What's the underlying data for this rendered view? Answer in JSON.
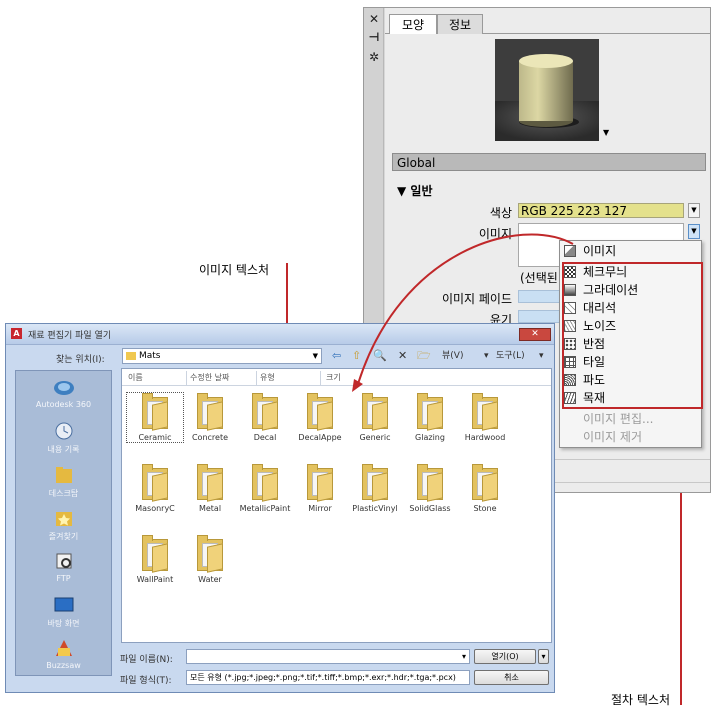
{
  "callouts": {
    "image_texture": "이미지 텍스처",
    "procedural_texture": "절차 텍스처"
  },
  "palette": {
    "strip_icons": [
      "close-icon",
      "pin-icon",
      "settings-icon"
    ],
    "strip_glyphs": [
      "✕",
      "⊣",
      "✲"
    ],
    "tabs": [
      "모양",
      "정보"
    ],
    "material_name": "Global",
    "section_label": "▼ 일반",
    "props": {
      "color_label": "색상",
      "color_value": "RGB 225 223 127",
      "image_label": "이미지",
      "image_placeholder": "(선택된",
      "image_fade_label": "이미지 페이드",
      "gloss_label": "윤기"
    },
    "colors": {
      "color_field": "#e4e18c",
      "accent_red": "#c0282a"
    }
  },
  "menu": {
    "top_item": "이미지",
    "procedural_items": [
      "체크무늬",
      "그라데이션",
      "대리석",
      "노이즈",
      "반점",
      "타일",
      "파도",
      "목재"
    ],
    "disabled_items": [
      "이미지 편집...",
      "이미지 제거"
    ]
  },
  "dialog": {
    "title": "재료 편집기 파일 열기",
    "look_in_label": "찾는 위치(I):",
    "look_in_value": "Mats",
    "toolbar": {
      "back": "⇦",
      "up": "⇧",
      "search": "🔍",
      "delete": "✕",
      "new_folder": "🗁",
      "views": "뷰(V)",
      "tools": "도구(L)"
    },
    "columns": [
      "이름",
      "수정한 날짜",
      "유형",
      "크기"
    ],
    "places": [
      "Autodesk 360",
      "내용 기록",
      "데스크탑",
      "즐겨찾기",
      "FTP",
      "바탕 화면",
      "Buzzsaw"
    ],
    "folders": [
      "Ceramic",
      "Concrete",
      "Decal",
      "DecalAppe",
      "Generic",
      "Glazing",
      "Hardwood",
      "MasonryC",
      "Metal",
      "MetallicPaint",
      "Mirror",
      "PlasticVinyl",
      "SolidGlass",
      "Stone",
      "WallPaint",
      "Water"
    ],
    "file_name_label": "파일 이름(N):",
    "file_name_value": "",
    "file_type_label": "파일 형식(T):",
    "file_type_value": "모든 유형 (*.jpg;*.jpeg;*.png;*.tif;*.tiff;*.bmp;*.exr;*.hdr;*.tga;*.pcx)",
    "open_button": "열기(O)",
    "cancel_button": "취소"
  }
}
